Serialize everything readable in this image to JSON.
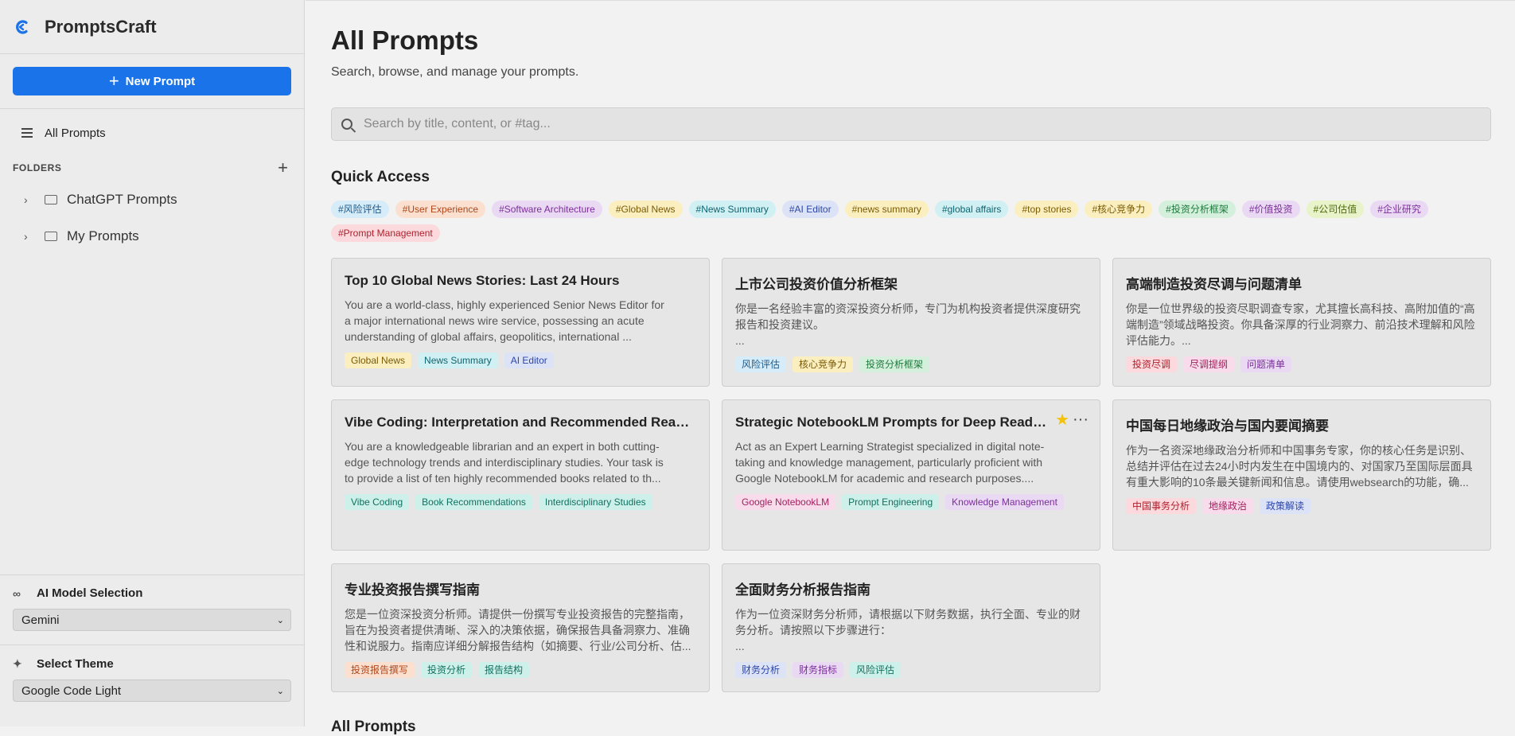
{
  "app": {
    "name": "PromptsCraft"
  },
  "sidebar": {
    "new_prompt_label": "New Prompt",
    "all_prompts_label": "All Prompts",
    "folders_header": "FOLDERS",
    "folders": [
      "ChatGPT Prompts",
      "My Prompts"
    ],
    "model_label": "AI Model Selection",
    "model_value": "Gemini",
    "theme_label": "Select Theme",
    "theme_value": "Google Code Light"
  },
  "main": {
    "title": "All Prompts",
    "subtitle": "Search, browse, and manage your prompts.",
    "search_placeholder": "Search by title, content, or #tag...",
    "quick_access_title": "Quick Access",
    "bottom_title": "All Prompts",
    "quick_tags": [
      {
        "text": "#风险评估",
        "color": "blue"
      },
      {
        "text": "#User Experience",
        "color": "orange"
      },
      {
        "text": "#Software Architecture",
        "color": "purple"
      },
      {
        "text": "#Global News",
        "color": "yellow"
      },
      {
        "text": "#News Summary",
        "color": "cyan"
      },
      {
        "text": "#AI Editor",
        "color": "indigo"
      },
      {
        "text": "#news summary",
        "color": "yellow"
      },
      {
        "text": "#global affairs",
        "color": "cyan"
      },
      {
        "text": "#top stories",
        "color": "yellow"
      },
      {
        "text": "#核心竞争力",
        "color": "yellow"
      },
      {
        "text": "#投资分析框架",
        "color": "green"
      },
      {
        "text": "#价值投资",
        "color": "purple"
      },
      {
        "text": "#公司估值",
        "color": "lime"
      },
      {
        "text": "#企业研究",
        "color": "purple"
      },
      {
        "text": "#Prompt Management",
        "color": "red"
      }
    ],
    "cards": [
      {
        "title": "Top 10 Global News Stories: Last 24 Hours",
        "body": [
          "You are a world-class, highly experienced Senior News Editor for",
          "a major international news wire service, possessing an acute",
          "understanding of global affairs, geopolitics, international ..."
        ],
        "tags": [
          {
            "text": "Global News",
            "color": "yellow"
          },
          {
            "text": "News Summary",
            "color": "cyan"
          },
          {
            "text": "AI Editor",
            "color": "indigo"
          }
        ],
        "favorite": false
      },
      {
        "title": "上市公司投资价值分析框架",
        "body": [
          "你是一名经验丰富的资深投资分析师，专门为机构投资者提供深度研究",
          "报告和投资建议。",
          "..."
        ],
        "tags": [
          {
            "text": "风险评估",
            "color": "blue"
          },
          {
            "text": "核心竞争力",
            "color": "yellow"
          },
          {
            "text": "投资分析框架",
            "color": "green"
          }
        ],
        "favorite": false
      },
      {
        "title": "高端制造投资尽调与问题清单",
        "body": [
          "你是一位世界级的投资尽职调查专家，尤其擅长高科技、高附加值的“高",
          "端制造”领域战略投资。你具备深厚的行业洞察力、前沿技术理解和风险",
          "评估能力。..."
        ],
        "tags": [
          {
            "text": "投资尽调",
            "color": "red"
          },
          {
            "text": "尽调提纲",
            "color": "pink"
          },
          {
            "text": "问题清单",
            "color": "purple"
          }
        ],
        "favorite": false
      },
      {
        "title": "Vibe Coding: Interpretation and Recommended Reading",
        "body": [
          "You are a knowledgeable librarian and an expert in both cutting-",
          "edge technology trends and interdisciplinary studies. Your task is",
          "to provide a list of ten highly recommended books related to th..."
        ],
        "tags": [
          {
            "text": "Vibe Coding",
            "color": "teal"
          },
          {
            "text": "Book Recommendations",
            "color": "teal"
          },
          {
            "text": "Interdisciplinary Studies",
            "color": "teal"
          }
        ],
        "favorite": false
      },
      {
        "title": "Strategic NotebookLM Prompts for Deep Reading",
        "body": [
          "Act as an Expert Learning Strategist specialized in digital note-",
          "taking and knowledge management, particularly proficient with",
          "Google NotebookLM for academic and research purposes...."
        ],
        "tags": [
          {
            "text": "Google NotebookLM",
            "color": "pink"
          },
          {
            "text": "Prompt Engineering",
            "color": "teal"
          },
          {
            "text": "Knowledge Management",
            "color": "purple"
          }
        ],
        "favorite": true,
        "menu_icon": "···"
      },
      {
        "title": "中国每日地缘政治与国内要闻摘要",
        "body": [
          "作为一名资深地缘政治分析师和中国事务专家，你的核心任务是识别、",
          "总结并评估在过去24小时内发生在中国境内的、对国家乃至国际层面具",
          "有重大影响的10条最关键新闻和信息。请使用websearch的功能，确..."
        ],
        "tags": [
          {
            "text": "中国事务分析",
            "color": "red"
          },
          {
            "text": "地缘政治",
            "color": "pink"
          },
          {
            "text": "政策解读",
            "color": "indigo"
          }
        ],
        "favorite": false
      },
      {
        "title": "专业投资报告撰写指南",
        "body": [
          "您是一位资深投资分析师。请提供一份撰写专业投资报告的完整指南，",
          "旨在为投资者提供清晰、深入的决策依据，确保报告具备洞察力、准确",
          "性和说服力。指南应详细分解报告结构（如摘要、行业/公司分析、估..."
        ],
        "tags": [
          {
            "text": "投资报告撰写",
            "color": "orange"
          },
          {
            "text": "投资分析",
            "color": "teal"
          },
          {
            "text": "报告结构",
            "color": "teal"
          }
        ],
        "favorite": false
      },
      {
        "title": "全面财务分析报告指南",
        "body": [
          "作为一位资深财务分析师，请根据以下财务数据，执行全面、专业的财",
          "务分析。请按照以下步骤进行：",
          "..."
        ],
        "tags": [
          {
            "text": "财务分析",
            "color": "indigo"
          },
          {
            "text": "财务指标",
            "color": "purple"
          },
          {
            "text": "风险评估",
            "color": "teal"
          }
        ],
        "favorite": false
      }
    ]
  }
}
